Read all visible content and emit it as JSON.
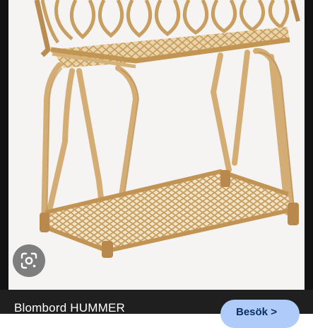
{
  "result": {
    "title": "Blombord HUMMER",
    "visit_label": "Besök >"
  },
  "icons": {
    "lens": "google-lens-icon"
  },
  "colors": {
    "page_bg": "#121212",
    "photo_bg": "#f5f4f2",
    "rattan": "#d2ac72",
    "visit_button_bg": "#aecbfa",
    "visit_button_text": "#0b2e63"
  }
}
